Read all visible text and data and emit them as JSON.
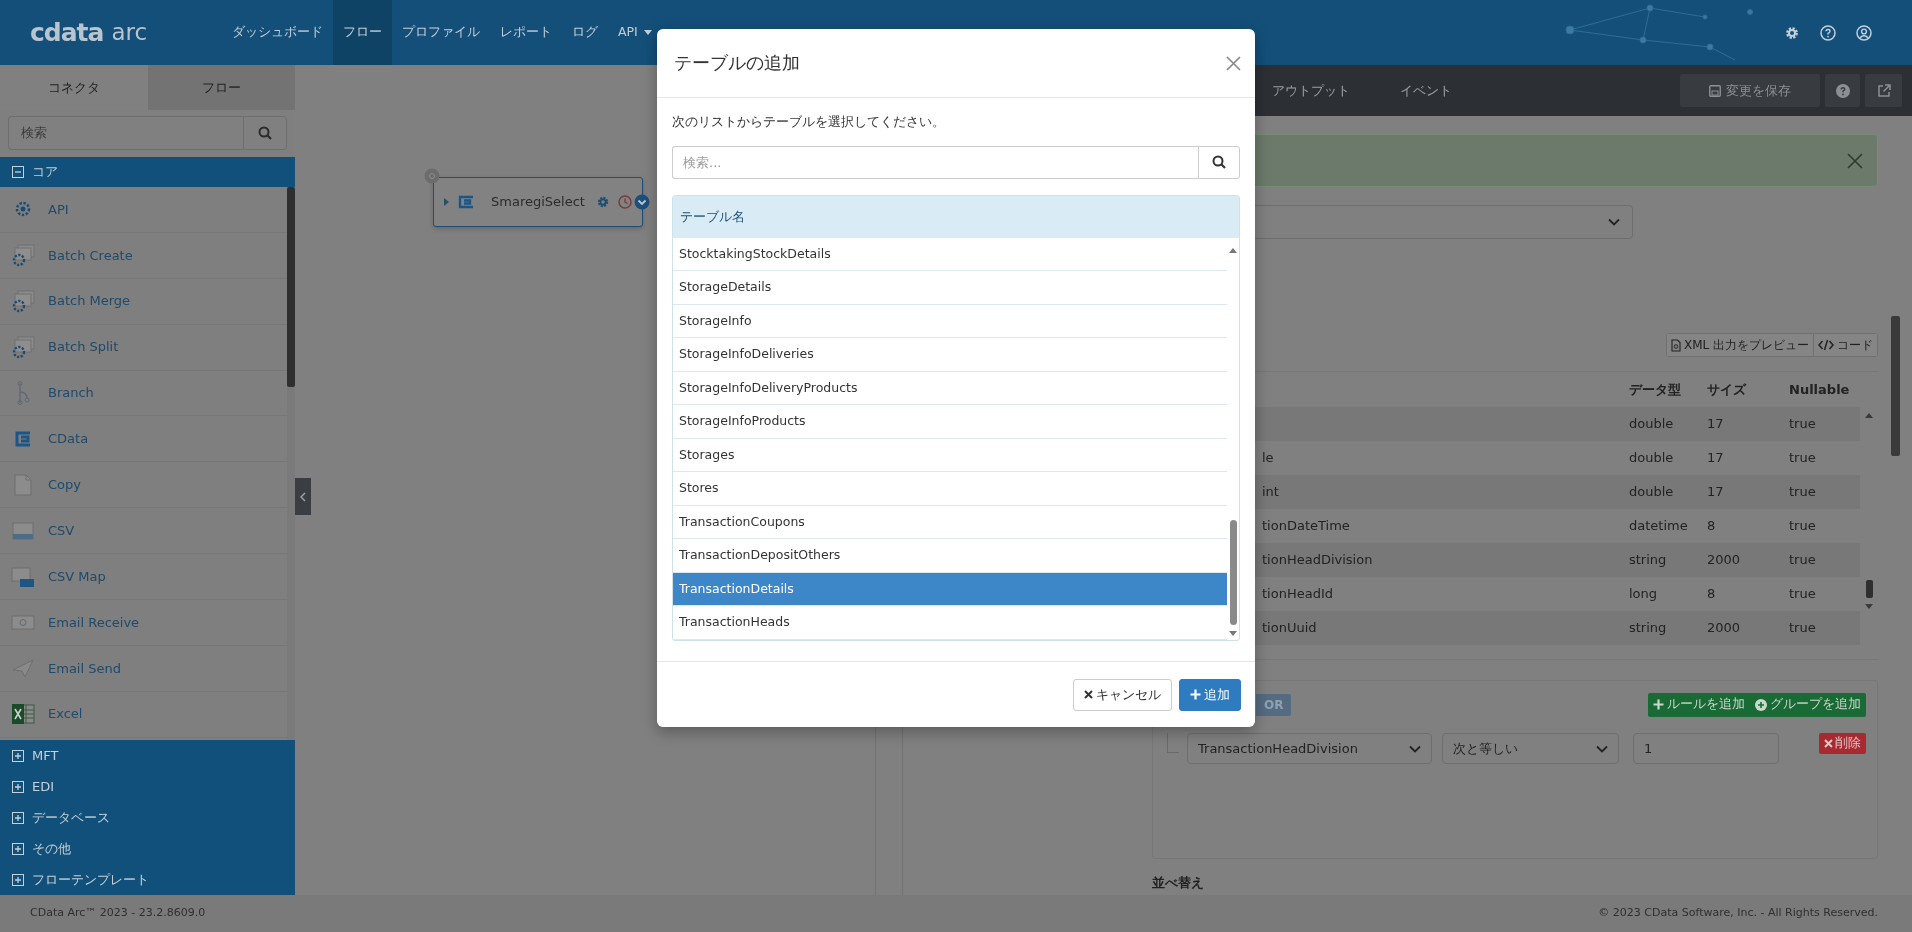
{
  "navbar": {
    "logo": {
      "mark": "cdata",
      "product": "arc"
    },
    "items": [
      {
        "label": "ダッシュボード",
        "selected": false,
        "dropdown": false
      },
      {
        "label": "フロー",
        "selected": true,
        "dropdown": false
      },
      {
        "label": "プロファイル",
        "selected": false,
        "dropdown": false
      },
      {
        "label": "レポート",
        "selected": false,
        "dropdown": false
      },
      {
        "label": "ログ",
        "selected": false,
        "dropdown": false
      },
      {
        "label": "API",
        "selected": false,
        "dropdown": true
      }
    ]
  },
  "sidebar": {
    "tabs": [
      {
        "label": "コネクタ",
        "selected": true
      },
      {
        "label": "フロー",
        "selected": false
      }
    ],
    "search": {
      "placeholder": "検索"
    },
    "categories": [
      {
        "label": "コア",
        "expanded": true,
        "items": [
          {
            "label": "API",
            "kind": "gear"
          },
          {
            "label": "Batch Create",
            "kind": "gear-stack"
          },
          {
            "label": "Batch Merge",
            "kind": "gear-stack"
          },
          {
            "label": "Batch Split",
            "kind": "gear-stack"
          },
          {
            "label": "Branch",
            "kind": "branch"
          },
          {
            "label": "CData",
            "kind": "cdata"
          },
          {
            "label": "Copy",
            "kind": "document"
          },
          {
            "label": "CSV",
            "kind": "csv"
          },
          {
            "label": "CSV Map",
            "kind": "map"
          },
          {
            "label": "Email Receive",
            "kind": "envelope"
          },
          {
            "label": "Email Send",
            "kind": "send"
          },
          {
            "label": "Excel",
            "kind": "excel"
          }
        ]
      },
      {
        "label": "MFT",
        "expanded": false
      },
      {
        "label": "EDI",
        "expanded": false
      },
      {
        "label": "データベース",
        "expanded": false
      },
      {
        "label": "その他",
        "expanded": false
      },
      {
        "label": "フローテンプレート",
        "expanded": false
      }
    ]
  },
  "canvas": {
    "node": {
      "label": "SmaregiSelect"
    }
  },
  "right_panel": {
    "tabs": [
      {
        "label": "アウトプット",
        "selected": false
      },
      {
        "label": "イベント",
        "selected": false
      }
    ],
    "save_button": "変更を保存",
    "preview_button": "XML 出力をプレビュー",
    "code_button": "コード",
    "columns_table": {
      "columns": [
        "データ型",
        "サイズ",
        "Nullable"
      ],
      "rows": [
        {
          "type": "double",
          "size": "17",
          "nullable": "true"
        },
        {
          "name": "le",
          "type": "double",
          "size": "17",
          "nullable": "true"
        },
        {
          "name": "int",
          "type": "double",
          "size": "17",
          "nullable": "true"
        },
        {
          "name": "tionDateTime",
          "type": "datetime",
          "size": "8",
          "nullable": "true"
        },
        {
          "name": "tionHeadDivision",
          "type": "string",
          "size": "2000",
          "nullable": "true"
        },
        {
          "name": "tionHeadId",
          "type": "long",
          "size": "8",
          "nullable": "true"
        },
        {
          "name": "tionUuid",
          "type": "string",
          "size": "2000",
          "nullable": "true"
        }
      ]
    },
    "filter": {
      "or_button": "OR",
      "add_rule": "ルールを追加",
      "add_group": "グループを追加",
      "rule": {
        "field": "TransactionHeadDivision",
        "operator": "次と等しい",
        "value": "1",
        "delete": "削除"
      }
    },
    "sort_label": "並べ替え"
  },
  "modal": {
    "title": "テーブルの追加",
    "instruction": "次のリストからテーブルを選択してください。",
    "search": {
      "placeholder": "検索..."
    },
    "column": "テーブル名",
    "rows": [
      {
        "label": "StocktakingStockDetails",
        "selected": false
      },
      {
        "label": "StorageDetails",
        "selected": false
      },
      {
        "label": "StorageInfo",
        "selected": false
      },
      {
        "label": "StorageInfoDeliveries",
        "selected": false
      },
      {
        "label": "StorageInfoDeliveryProducts",
        "selected": false
      },
      {
        "label": "StorageInfoProducts",
        "selected": false
      },
      {
        "label": "Storages",
        "selected": false
      },
      {
        "label": "Stores",
        "selected": false
      },
      {
        "label": "TransactionCoupons",
        "selected": false
      },
      {
        "label": "TransactionDepositOthers",
        "selected": false
      },
      {
        "label": "TransactionDetails",
        "selected": true
      },
      {
        "label": "TransactionHeads",
        "selected": false
      }
    ],
    "buttons": [
      {
        "label": "キャンセル",
        "kind": "cancel"
      },
      {
        "label": "追加",
        "kind": "primary"
      }
    ]
  },
  "footer": {
    "version": "CData Arc™ 2023 - 23.2.8609.0",
    "copyright": "© 2023 CData Software, Inc. - All Rights Reserved."
  }
}
